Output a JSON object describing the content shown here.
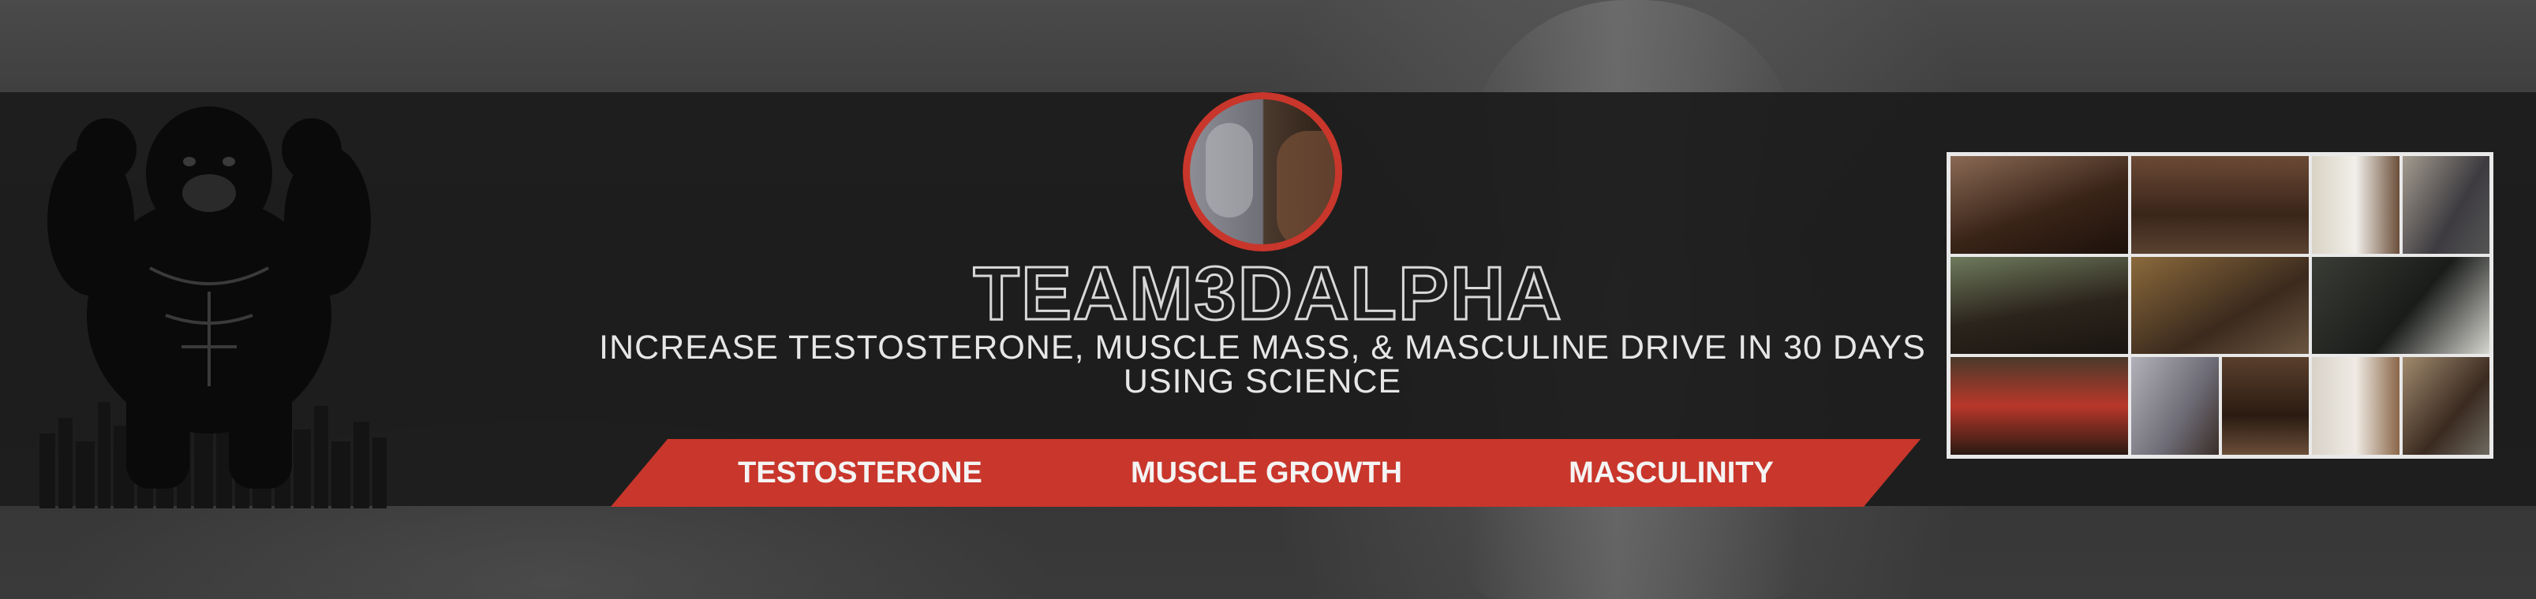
{
  "brand": {
    "name": "TEAM3DALPHA"
  },
  "tagline": {
    "line1": "INCREASE TESTOSTERONE, MUSCLE MASS, & MASCULINE DRIVE IN 30 DAYS",
    "line2": "USING SCIENCE"
  },
  "tabs": [
    {
      "label": "TESTOSTERONE"
    },
    {
      "label": "MUSCLE GROWTH"
    },
    {
      "label": "MASCULINITY"
    }
  ],
  "colors": {
    "accent": "#c9362b",
    "band": "#1c1c1c",
    "text": "#e6e6e6"
  },
  "icons": {
    "logo": "gorilla-skyline-icon"
  }
}
